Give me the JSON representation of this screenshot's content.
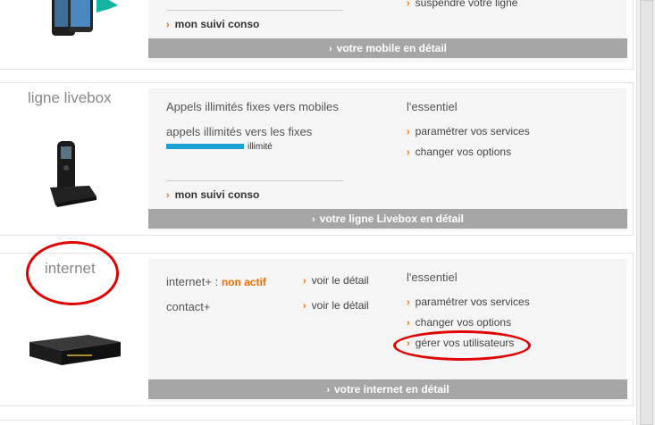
{
  "colors": {
    "accent_orange": "#f16e00",
    "bar_gray": "#a6a6a6",
    "usage_blue": "#1ba3d5",
    "highlight_red": "#e00000"
  },
  "mobile": {
    "suspend_link": "suspendre votre ligne",
    "suivi_link": "mon suivi conso",
    "detail_bar": "votre mobile en détail"
  },
  "livebox": {
    "title": "ligne livebox",
    "usage_line1": "Appels illimités fixes vers mobiles",
    "usage_line2": "appels illimités vers les fixes",
    "usage_badge": "illimité",
    "essentiel_title": "l'essentiel",
    "links": [
      "paramétrer vos services",
      "changer vos options"
    ],
    "suivi_link": "mon suivi conso",
    "detail_bar": "votre ligne Livebox en détail"
  },
  "internet": {
    "title": "internet",
    "service1_label": "internet+ :",
    "service1_status": "non actif",
    "service2_label": "contact+",
    "detail_link": "voir le détail",
    "essentiel_title": "l'essentiel",
    "links": [
      "paramétrer vos services",
      "changer vos options",
      "gérer vos utilisateurs"
    ],
    "detail_bar": "votre internet en détail"
  }
}
